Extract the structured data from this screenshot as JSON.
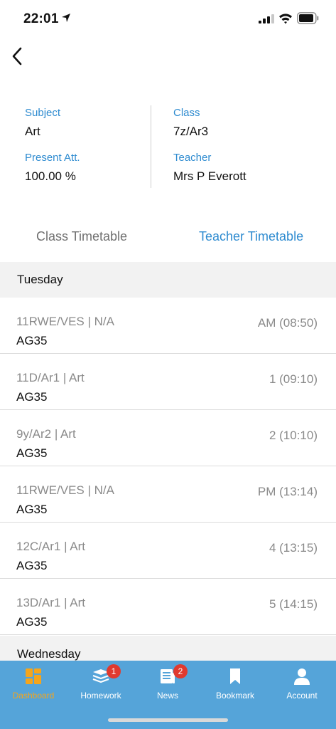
{
  "status_bar": {
    "time": "22:01"
  },
  "info": {
    "subject_label": "Subject",
    "subject_value": "Art",
    "class_label": "Class",
    "class_value": "7z/Ar3",
    "attendance_label": "Present Att.",
    "attendance_value": "100.00 %",
    "teacher_label": "Teacher",
    "teacher_value": "Mrs P Everott"
  },
  "tabs": {
    "class_timetable": "Class Timetable",
    "teacher_timetable": "Teacher Timetable"
  },
  "days": {
    "tuesday": "Tuesday",
    "wednesday": "Wednesday"
  },
  "lessons": [
    {
      "title": "11RWE/VES | N/A",
      "room": "AG35",
      "time": "AM (08:50)"
    },
    {
      "title": "11D/Ar1 | Art",
      "room": "AG35",
      "time": "1 (09:10)"
    },
    {
      "title": "9y/Ar2 | Art",
      "room": "AG35",
      "time": "2 (10:10)"
    },
    {
      "title": "11RWE/VES | N/A",
      "room": "AG35",
      "time": "PM (13:14)"
    },
    {
      "title": "12C/Ar1 | Art",
      "room": "AG35",
      "time": "4 (13:15)"
    },
    {
      "title": "13D/Ar1 | Art",
      "room": "AG35",
      "time": "5 (14:15)"
    }
  ],
  "tabbar": {
    "dashboard": "Dashboard",
    "homework": "Homework",
    "homework_badge": "1",
    "news": "News",
    "news_badge": "2",
    "bookmark": "Bookmark",
    "account": "Account"
  },
  "colors": {
    "accent": "#2e8bd0",
    "tabbar": "#55a4d9",
    "active_tab": "#f5a51c",
    "badge": "#e03a2f"
  }
}
